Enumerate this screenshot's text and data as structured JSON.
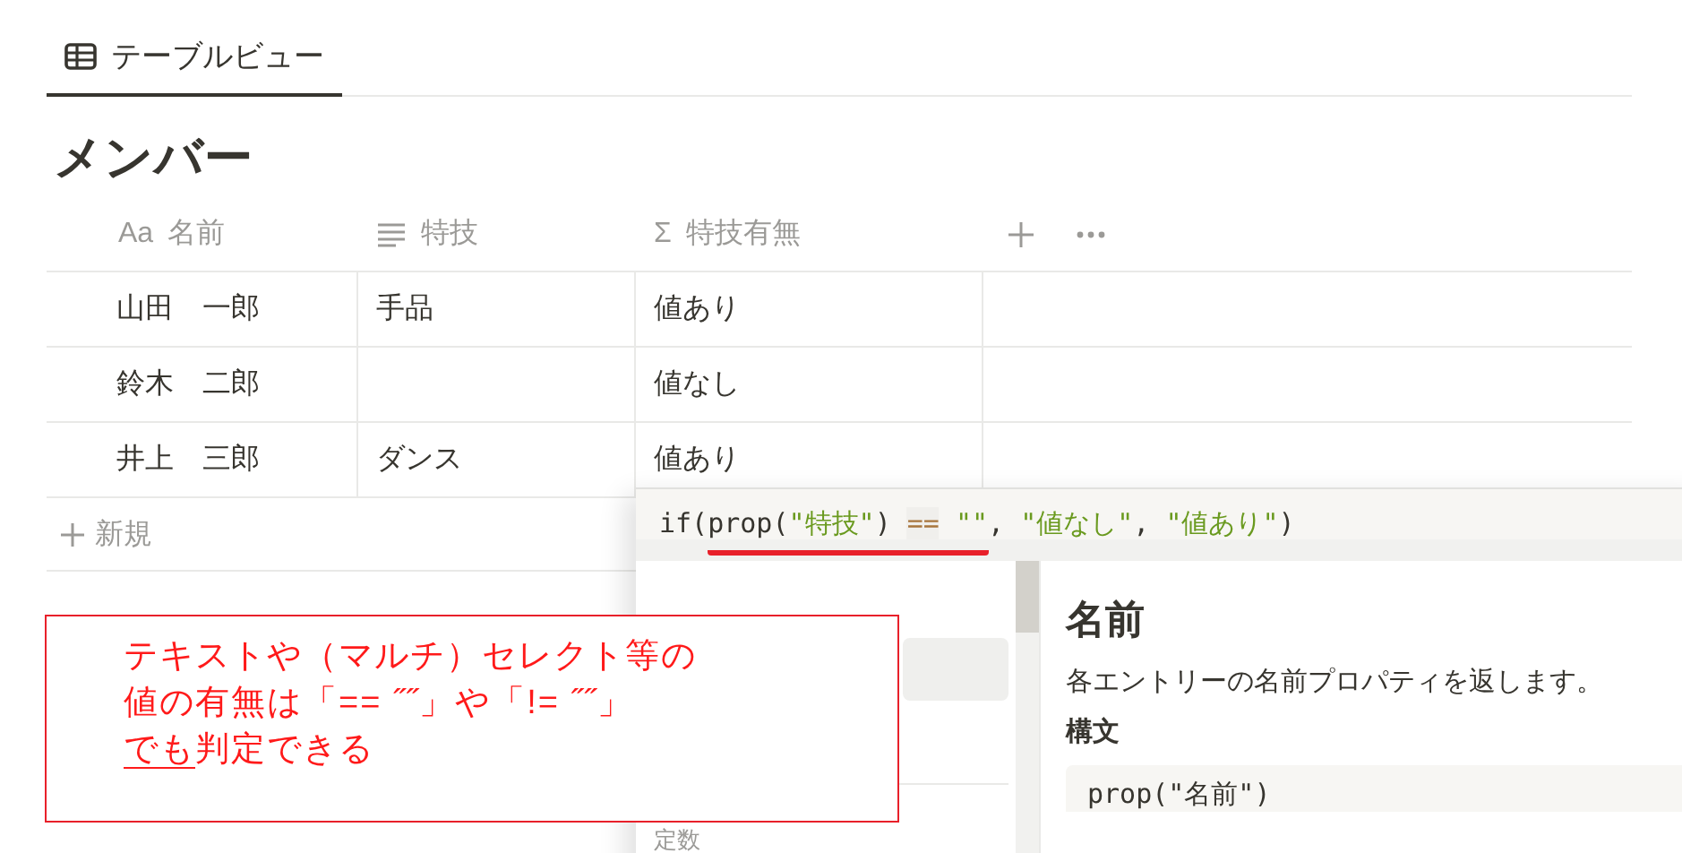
{
  "tabs": [
    {
      "label": "テーブルビュー",
      "selected": true
    }
  ],
  "title": "メンバー",
  "table": {
    "columns": [
      {
        "label": "名前",
        "kind": "title",
        "icon": "Aa"
      },
      {
        "label": "特技",
        "kind": "text"
      },
      {
        "label": "特技有無",
        "kind": "formula",
        "icon": "Σ"
      }
    ],
    "rows": [
      [
        "山田　一郎",
        "手品",
        "値あり"
      ],
      [
        "鈴木　二郎",
        "",
        "値なし"
      ],
      [
        "井上　三郎",
        "ダンス",
        "値あり"
      ]
    ],
    "new_row": "新規"
  },
  "formula_editor": {
    "groups": [
      {
        "underlined": false,
        "tokens": [
          {
            "text": "if(",
            "kind": "plain"
          }
        ]
      },
      {
        "underlined": true,
        "tokens": [
          {
            "text": "prop(",
            "kind": "plain"
          },
          {
            "text": "\"特技\"",
            "kind": "string"
          },
          {
            "text": ") ",
            "kind": "plain"
          },
          {
            "text": "==",
            "kind": "operator"
          },
          {
            "text": " \"\"",
            "kind": "string"
          }
        ]
      },
      {
        "underlined": false,
        "tokens": [
          {
            "text": ", ",
            "kind": "plain"
          },
          {
            "text": "\"値なし\"",
            "kind": "string"
          },
          {
            "text": ", ",
            "kind": "plain"
          },
          {
            "text": "\"値あり\"",
            "kind": "string"
          },
          {
            "text": ")",
            "kind": "plain"
          }
        ]
      }
    ],
    "list_items": [
      {
        "selected": true
      }
    ],
    "section_heading": "定数",
    "detail": {
      "title": "名前",
      "description": "各エントリーの名前プロパティを返します。",
      "syntax_heading": "構文",
      "syntax": "prop(\"名前\")"
    }
  },
  "callout": {
    "lines": [
      [
        {
          "text": "テキストや（マルチ）セレクト等の",
          "underlined": false
        }
      ],
      [
        {
          "text": "値の有無は「== ˝˝」や「!= ˝˝」",
          "underlined": false
        }
      ],
      [
        {
          "text": "でも",
          "underlined": true
        },
        {
          "text": "判定できる",
          "underlined": false
        }
      ]
    ]
  }
}
